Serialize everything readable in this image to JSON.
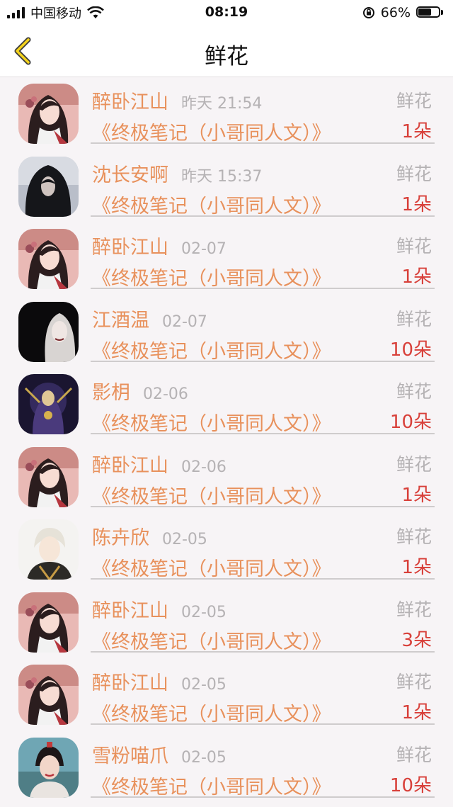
{
  "status_bar": {
    "carrier": "中国移动",
    "time": "08:19",
    "battery": "66%",
    "battery_level": 0.66
  },
  "header": {
    "title": "鲜花",
    "back_icon": "chevron-left-icon"
  },
  "colors": {
    "accent": "#e8915c",
    "count": "#d8403a",
    "muted": "#b5b2b4"
  },
  "items": [
    {
      "user": "醉卧江山",
      "time": "昨天 21:54",
      "label": "鲜花",
      "book": "《终极笔记（小哥同人文）》",
      "count": "1朵",
      "avatar": "avatar-0"
    },
    {
      "user": "沈长安啊",
      "time": "昨天 15:37",
      "label": "鲜花",
      "book": "《终极笔记（小哥同人文）》",
      "count": "1朵",
      "avatar": "avatar-1"
    },
    {
      "user": "醉卧江山",
      "time": "02-07",
      "label": "鲜花",
      "book": "《终极笔记（小哥同人文）》",
      "count": "1朵",
      "avatar": "avatar-0"
    },
    {
      "user": "江酒温",
      "time": "02-07",
      "label": "鲜花",
      "book": "《终极笔记（小哥同人文）》",
      "count": "10朵",
      "avatar": "avatar-2"
    },
    {
      "user": "影枂",
      "time": "02-06",
      "label": "鲜花",
      "book": "《终极笔记（小哥同人文）》",
      "count": "10朵",
      "avatar": "avatar-3"
    },
    {
      "user": "醉卧江山",
      "time": "02-06",
      "label": "鲜花",
      "book": "《终极笔记（小哥同人文）》",
      "count": "1朵",
      "avatar": "avatar-0"
    },
    {
      "user": "陈卉欣",
      "time": "02-05",
      "label": "鲜花",
      "book": "《终极笔记（小哥同人文）》",
      "count": "1朵",
      "avatar": "avatar-4"
    },
    {
      "user": "醉卧江山",
      "time": "02-05",
      "label": "鲜花",
      "book": "《终极笔记（小哥同人文）》",
      "count": "3朵",
      "avatar": "avatar-0"
    },
    {
      "user": "醉卧江山",
      "time": "02-05",
      "label": "鲜花",
      "book": "《终极笔记（小哥同人文）》",
      "count": "1朵",
      "avatar": "avatar-0"
    },
    {
      "user": "雪粉喵爪",
      "time": "02-05",
      "label": "鲜花",
      "book": "《终极笔记（小哥同人文）》",
      "count": "10朵",
      "avatar": "avatar-5"
    }
  ]
}
